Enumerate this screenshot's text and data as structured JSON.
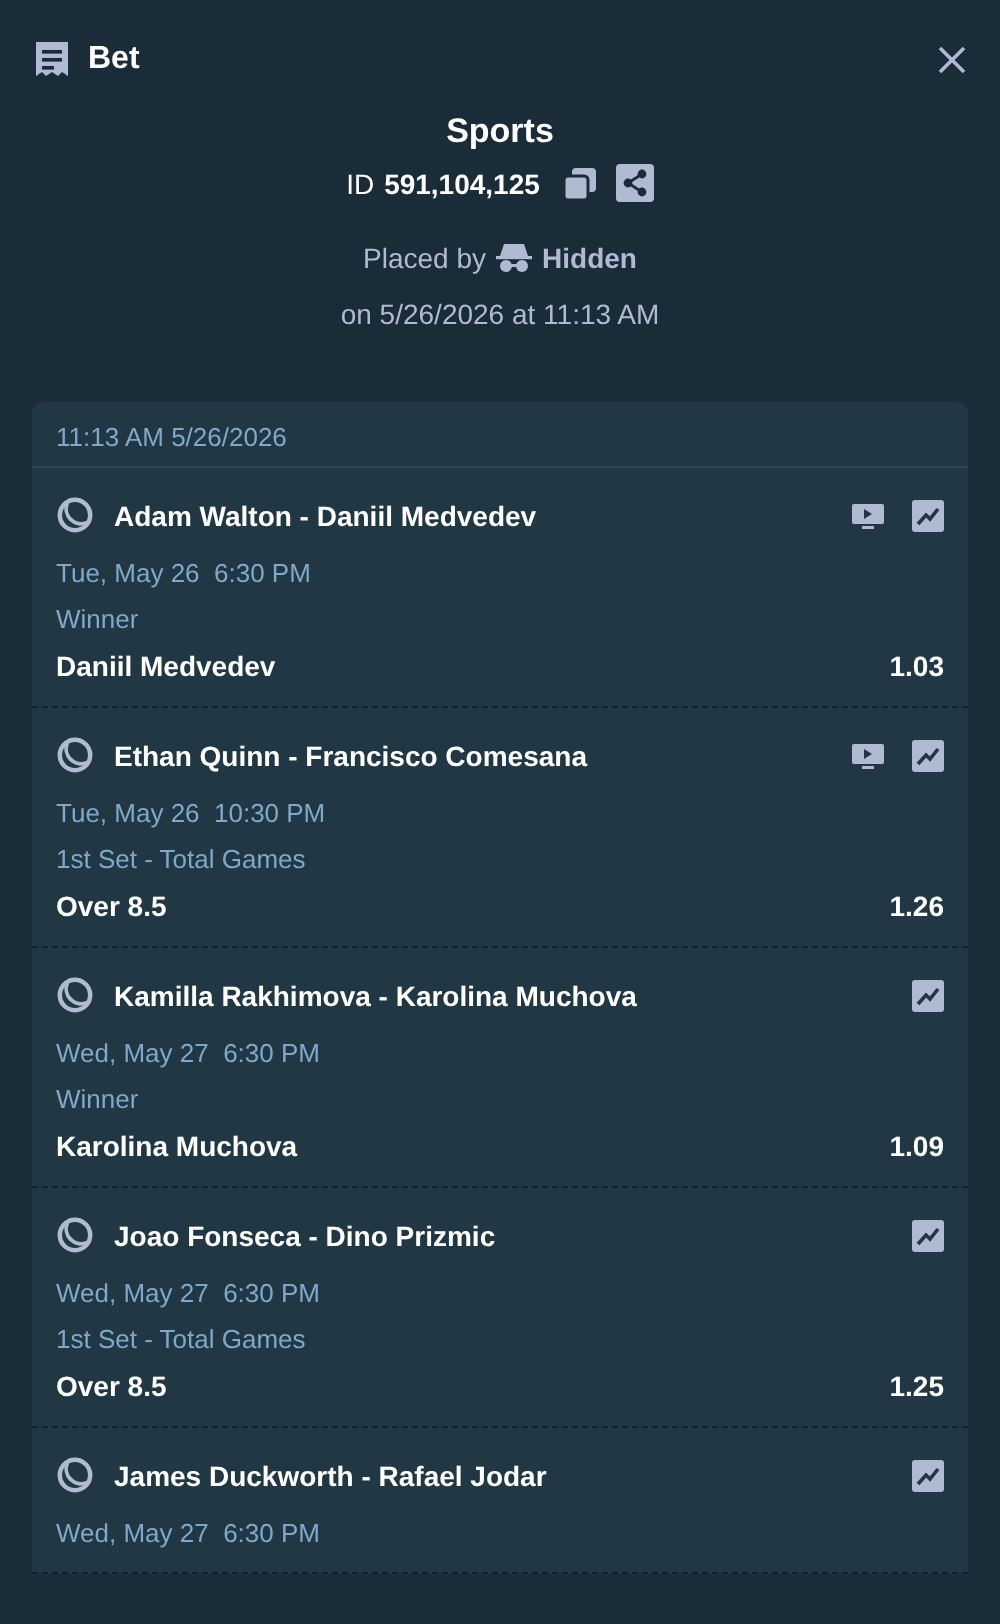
{
  "header": {
    "title": "Bet"
  },
  "summary": {
    "category": "Sports",
    "id_label": "ID",
    "id_value": "591,104,125",
    "placed_by_label": "Placed by",
    "placed_by_user": "Hidden",
    "placed_on": "on 5/26/2026 at 11:13 AM"
  },
  "slip": {
    "timestamp": "11:13 AM 5/26/2026",
    "legs": [
      {
        "event": "Adam Walton - Daniil Medvedev",
        "live_stream": true,
        "start": "Tue, May 26  6:30 PM",
        "market": "Winner",
        "selection": "Daniil Medvedev",
        "odds": "1.03"
      },
      {
        "event": "Ethan Quinn - Francisco Comesana",
        "live_stream": true,
        "start": "Tue, May 26  10:30 PM",
        "market": "1st Set - Total Games",
        "selection": "Over 8.5",
        "odds": "1.26"
      },
      {
        "event": "Kamilla Rakhimova - Karolina Muchova",
        "live_stream": false,
        "start": "Wed, May 27  6:30 PM",
        "market": "Winner",
        "selection": "Karolina Muchova",
        "odds": "1.09"
      },
      {
        "event": "Joao Fonseca - Dino Prizmic",
        "live_stream": false,
        "start": "Wed, May 27  6:30 PM",
        "market": "1st Set - Total Games",
        "selection": "Over 8.5",
        "odds": "1.25"
      },
      {
        "event": "James Duckworth - Rafael Jodar",
        "live_stream": false,
        "start": "Wed, May 27  6:30 PM"
      }
    ]
  }
}
